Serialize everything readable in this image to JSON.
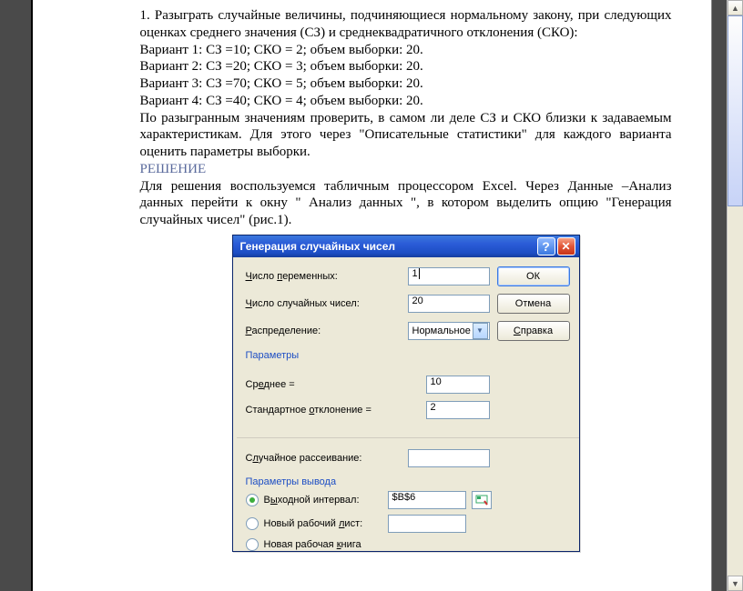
{
  "text": {
    "p1": "1. Разыграть   случайные  величины,  подчиняющиеся  нормальному закону,   при   следующих   оценках   среднего  значения  (СЗ)   и среднеквадратичного  отклонения  (СКО):",
    "v1": "Вариант  1:  СЗ =10;  СКО = 2; объем выборки: 20.",
    "v2": "Вариант  2:  СЗ =20;  СКО = 3; объем выборки: 20.",
    "v3": "Вариант  3:  СЗ =70;  СКО = 5; объем выборки: 20.",
    "v4": "Вариант  4:  СЗ =40;  СКО = 4; объем выборки: 20.",
    "p2": "   По  разыгранным  значениям  проверить,  в  самом  ли  деле  СЗ  и СКО близки  к  задаваемым  характеристикам.  Для  этого  через \"Описательные статистики\"   для   каждого   варианта   оценить   параметры  выборки.",
    "solution": "РЕШЕНИЕ",
    "p3": "Для решения  воспользуемся  табличным процессором  Excel.   Через  Данные –Анализ  данных  перейти   к окну  \" Анализ  данных \",  в котором  выделить опцию  \"Генерация  случайных чисел\"  (рис.1)."
  },
  "dialog": {
    "title": "Генерация случайных чисел",
    "labels": {
      "numVars": "Число переменных:",
      "numRand": "Число случайных чисел:",
      "dist": "Распределение:",
      "params": "Параметры",
      "mean": "Среднее =",
      "stdev": "Стандартное отклонение =",
      "seed": "Случайное рассеивание:",
      "outgroup": "Параметры вывода",
      "outRange": "Выходной интервал:",
      "newSheet": "Новый рабочий лист:",
      "newBook": "Новая рабочая книга"
    },
    "values": {
      "numVars": "1",
      "numRand": "20",
      "dist": "Нормальное",
      "mean": "10",
      "stdev": "2",
      "seed": "",
      "outRange": "$B$6",
      "newSheet": ""
    },
    "buttons": {
      "ok": "ОК",
      "cancel": "Отмена",
      "help": "Справка"
    },
    "selectedOutput": "outRange"
  }
}
